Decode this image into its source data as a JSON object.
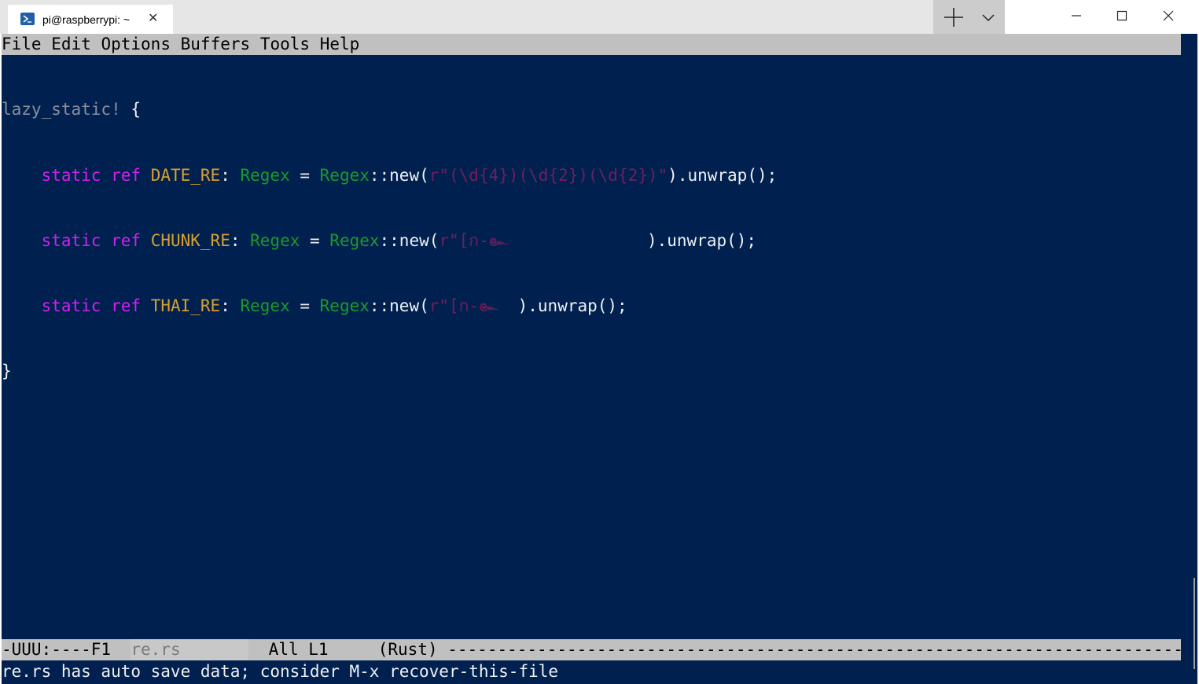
{
  "window": {
    "tab_title": "pi@raspberrypi: ~",
    "tab_close": "✕"
  },
  "menubar": {
    "items": [
      "File",
      "Edit",
      "Options",
      "Buffers",
      "Tools",
      "Help"
    ]
  },
  "editor": {
    "lines": [
      [
        {
          "t": "lazy_static!",
          "c": "macro"
        },
        {
          "t": " {",
          "c": "plain"
        }
      ],
      [
        {
          "t": "    ",
          "c": "plain"
        },
        {
          "t": "static",
          "c": "kw"
        },
        {
          "t": " ",
          "c": "plain"
        },
        {
          "t": "ref",
          "c": "kw"
        },
        {
          "t": " ",
          "c": "plain"
        },
        {
          "t": "DATE_RE",
          "c": "const"
        },
        {
          "t": ": ",
          "c": "plain"
        },
        {
          "t": "Regex",
          "c": "type"
        },
        {
          "t": " = ",
          "c": "plain"
        },
        {
          "t": "Regex",
          "c": "type"
        },
        {
          "t": "::new(",
          "c": "plain"
        },
        {
          "t": "r\"(\\d{4})(\\d{2})(\\d{2})\"",
          "c": "str"
        },
        {
          "t": ").unwrap();",
          "c": "plain"
        }
      ],
      [
        {
          "t": "    ",
          "c": "plain"
        },
        {
          "t": "static",
          "c": "kw"
        },
        {
          "t": " ",
          "c": "plain"
        },
        {
          "t": "ref",
          "c": "kw"
        },
        {
          "t": " ",
          "c": "plain"
        },
        {
          "t": "CHUNK_RE",
          "c": "const"
        },
        {
          "t": ": ",
          "c": "plain"
        },
        {
          "t": "Regex",
          "c": "type"
        },
        {
          "t": " = ",
          "c": "plain"
        },
        {
          "t": "Regex",
          "c": "type"
        },
        {
          "t": "::new(",
          "c": "plain"
        },
        {
          "t": "r\"[ก-๛",
          "c": "str"
        },
        {
          "t": "              ",
          "c": "str"
        },
        {
          "t": ").unwrap();",
          "c": "plain"
        }
      ],
      [
        {
          "t": "    ",
          "c": "plain"
        },
        {
          "t": "static",
          "c": "kw"
        },
        {
          "t": " ",
          "c": "plain"
        },
        {
          "t": "ref",
          "c": "kw"
        },
        {
          "t": " ",
          "c": "plain"
        },
        {
          "t": "THAI_RE",
          "c": "const"
        },
        {
          "t": ": ",
          "c": "plain"
        },
        {
          "t": "Regex",
          "c": "type"
        },
        {
          "t": " = ",
          "c": "plain"
        },
        {
          "t": "Regex",
          "c": "type"
        },
        {
          "t": "::new(",
          "c": "plain"
        },
        {
          "t": "r\"[ก-๛",
          "c": "str"
        },
        {
          "t": "  ",
          "c": "str"
        },
        {
          "t": ").unwrap();",
          "c": "plain"
        }
      ],
      [
        {
          "t": "}",
          "c": "plain"
        }
      ]
    ]
  },
  "modeline": {
    "status": "-UUU:----F1  ",
    "buffer": "re.rs",
    "position": "All L1",
    "mode": "(Rust)",
    "fill": " --------------------------------------------------------------------------"
  },
  "echo_area": {
    "message": "re.rs has auto save data; consider M-x recover-this-file"
  },
  "colors": {
    "background": "#002150",
    "keyword": "#d21ff0",
    "constant": "#d8a02c",
    "type": "#1a9a2a",
    "string": "#6e1f5c",
    "bars": "#c0c0c0"
  }
}
